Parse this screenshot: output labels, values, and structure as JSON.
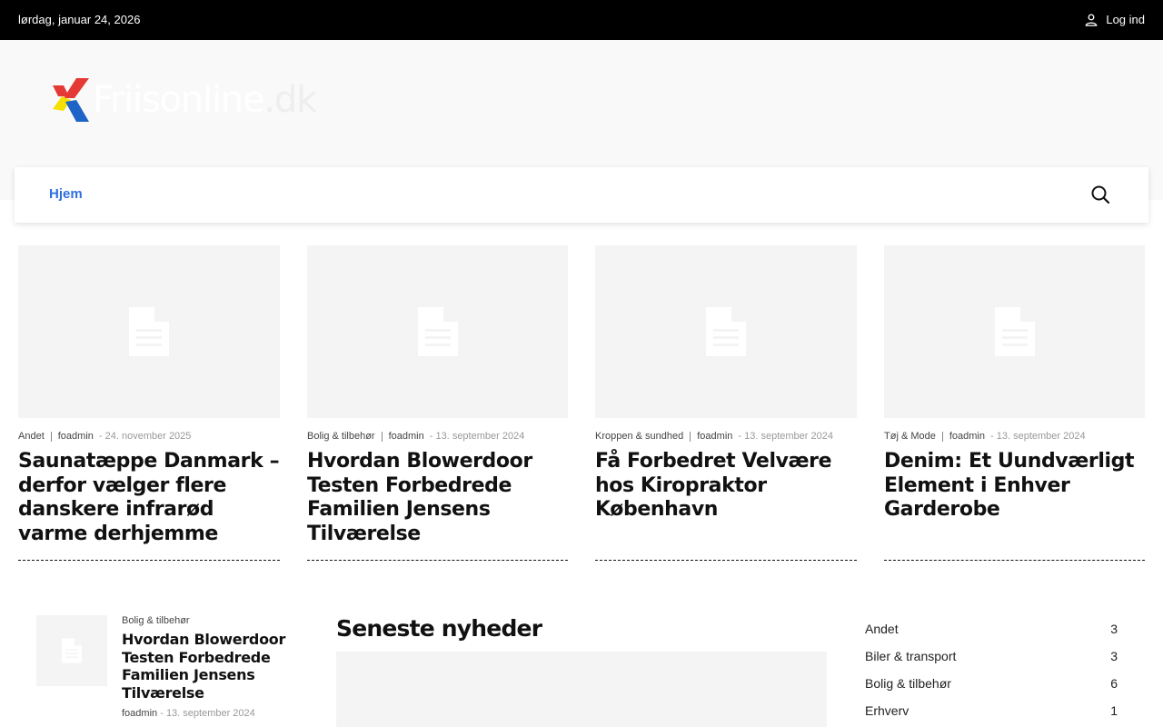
{
  "topbar": {
    "date": "lørdag, januar 24, 2026",
    "login_label": "Log ind"
  },
  "logo": {
    "wordmark": "Friisonline",
    "tld": ".dk"
  },
  "nav": {
    "items": [
      {
        "label": "Hjem"
      }
    ]
  },
  "colors": {
    "accent": "#2f6fe0",
    "topbar_bg": "#000000",
    "header_bg": "#f9f9f9",
    "placeholder_bg": "#f4f4f4"
  },
  "articles": [
    {
      "category": "Andet",
      "author": "foadmin",
      "date": "24. november 2025",
      "title": "Saunatæppe Danmark – derfor vælger flere danskere infrarød varme derhjemme"
    },
    {
      "category": "Bolig & tilbehør",
      "author": "foadmin",
      "date": "13. september 2024",
      "title": "Hvordan Blowerdoor Testen Forbedrede Familien Jensens Tilværelse"
    },
    {
      "category": "Kroppen & sundhed",
      "author": "foadmin",
      "date": "13. september 2024",
      "title": "Få Forbedret Velvære hos Kiropraktor København"
    },
    {
      "category": "Tøj & Mode",
      "author": "foadmin",
      "date": "13. september 2024",
      "title": "Denim: Et Uundværligt Element i Enhver Garderobe"
    }
  ],
  "side_post": {
    "category": "Bolig & tilbehør",
    "title": "Hvordan Blowerdoor Testen Forbedrede Familien Jensens Tilværelse",
    "author": "foadmin",
    "date": "13. september 2024"
  },
  "latest": {
    "title": "Seneste nyheder"
  },
  "categories": [
    {
      "name": "Andet",
      "count": "3"
    },
    {
      "name": "Biler & transport",
      "count": "3"
    },
    {
      "name": "Bolig & tilbehør",
      "count": "6"
    },
    {
      "name": "Erhverv",
      "count": "1"
    }
  ]
}
